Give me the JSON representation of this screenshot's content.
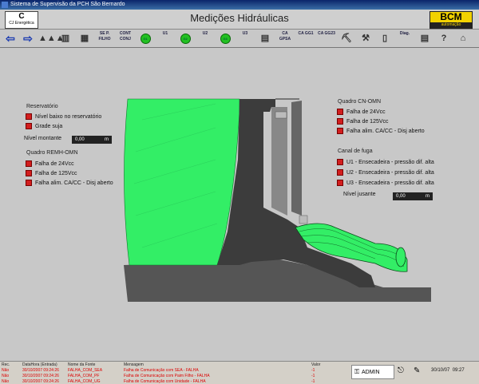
{
  "window": {
    "title": "Sistema de Supervisão da PCH São Bernardo"
  },
  "header": {
    "title": "Medições Hidráulicas",
    "logo_left": "CJ Energética",
    "logo_right": "BCM",
    "logo_right_sub": "automação"
  },
  "toolbar": [
    {
      "name": "back-icon",
      "label": "⇦",
      "kind": "arrow"
    },
    {
      "name": "forward-icon",
      "label": "⇨",
      "kind": "arrow"
    },
    {
      "name": "alarm-panel-icon",
      "label": "▲▲▲",
      "kind": "ico"
    },
    {
      "name": "building-icon",
      "label": "▥",
      "kind": "ico"
    },
    {
      "name": "diagram-icon",
      "label": "▦",
      "kind": "ico"
    },
    {
      "name": "se-p-filho-button",
      "label": "SE P. FILHO",
      "kind": "txt"
    },
    {
      "name": "cont-conj-button",
      "label": "CONT CONJ",
      "kind": "txt"
    },
    {
      "name": "g1-icon",
      "label": "G1",
      "kind": "circ"
    },
    {
      "name": "u1-button",
      "label": "U1",
      "kind": "txt"
    },
    {
      "name": "g2-icon",
      "label": "G2",
      "kind": "circ"
    },
    {
      "name": "u2-button",
      "label": "U2",
      "kind": "txt"
    },
    {
      "name": "g3-icon",
      "label": "G3",
      "kind": "circ"
    },
    {
      "name": "u3-button",
      "label": "U3",
      "kind": "txt"
    },
    {
      "name": "filter-icon",
      "label": "▤",
      "kind": "ico"
    },
    {
      "name": "ca-gpsa-button",
      "label": "CA GPSA",
      "kind": "txt"
    },
    {
      "name": "ca-gg1-button",
      "label": "CA GG1",
      "kind": "txt"
    },
    {
      "name": "ca-gg23-button",
      "label": "CA GG23",
      "kind": "txt"
    },
    {
      "name": "excavator-icon",
      "label": "⛏",
      "kind": "ico"
    },
    {
      "name": "tools-icon",
      "label": "⚒",
      "kind": "ico"
    },
    {
      "name": "document-icon",
      "label": "▯",
      "kind": "ico"
    },
    {
      "name": "diag-button",
      "label": "Diag.",
      "kind": "txt"
    },
    {
      "name": "report-icon",
      "label": "▤",
      "kind": "ico"
    },
    {
      "name": "help-icon",
      "label": "?",
      "kind": "ico"
    },
    {
      "name": "home-icon",
      "label": "⌂",
      "kind": "ico"
    }
  ],
  "reservatorio": {
    "title": "Reservatório",
    "alarms": [
      "Nível baixo no reservatório",
      "Grade suja"
    ],
    "level_label": "Nível montante",
    "level_value": "0,00",
    "level_unit": "m"
  },
  "quadro_remh": {
    "title": "Quadro REMH-OMN",
    "alarms": [
      "Falha de 24Vcc",
      "Falha de 125Vcc",
      "Falha alim. CA/CC - Disj aberto"
    ]
  },
  "quadro_cn": {
    "title": "Quadro CN-OMN",
    "alarms": [
      "Falha de 24Vcc",
      "Falha de 125Vcc",
      "Falha alim. CA/CC - Disj aberto"
    ]
  },
  "canal_fuga": {
    "title": "Canal de fuga",
    "alarms": [
      "U1 - Ensecadeira - pressão dif. alta",
      "U2 - Ensecadeira - pressão dif. alta",
      "U3 - Ensecadeira - pressão dif. alta"
    ],
    "level_label": "Nível jusante",
    "level_value": "0,00",
    "level_unit": "m"
  },
  "events": {
    "headers": [
      "Rec.",
      "DataHora (Entrada)",
      "Nome da Fonte",
      "Mensagem",
      "Valor"
    ],
    "rows": [
      [
        "Não",
        "30/10/2007 09:24:26",
        "FALHA_COM_SEA",
        "Falha de Comunicação com SEA - FALHA",
        "-1"
      ],
      [
        "Não",
        "30/10/2007 09:24:26",
        "FALHA_COM_PF",
        "Falha de Comunicação com Paim Filho - FALHA",
        "-1"
      ],
      [
        "Não",
        "30/10/2007 09:24:26",
        "FALHA_COM_UG",
        "Falha de Comunicação com Unidade - FALHA",
        "-1"
      ]
    ]
  },
  "user": {
    "name": "ADMIN"
  },
  "clock": {
    "date": "30/10/07",
    "time": "09:27"
  },
  "colors": {
    "water": "#33ee66",
    "alarm": "#d21e1e",
    "concrete": "#3c3c3c"
  }
}
